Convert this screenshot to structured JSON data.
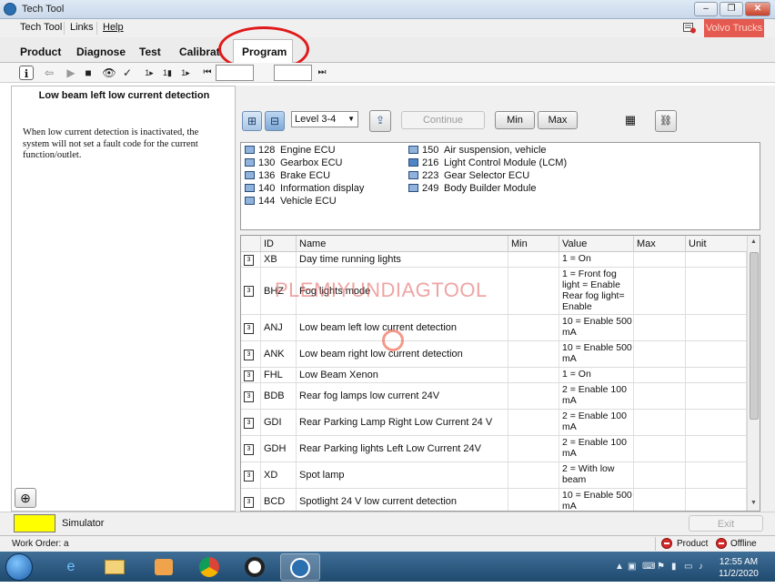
{
  "window": {
    "title": "Tech Tool",
    "controls": [
      "–",
      "❐",
      "✕"
    ]
  },
  "menu": {
    "items": [
      "Tech Tool",
      "Links",
      "Help"
    ],
    "brand_button": "Volvo Trucks"
  },
  "tabs": [
    "Product",
    "Diagnose",
    "Test",
    "Calibrat",
    "Program"
  ],
  "active_tab": "Program",
  "toolbar": {
    "page_input": "",
    "page_input2": ""
  },
  "left_panel": {
    "title": "Low beam left low current detection",
    "description": "When low current detection is inactivated, the system will not set a fault code for the current function/outlet."
  },
  "controls": {
    "level_select": "Level 3-4",
    "continue_label": "Continue",
    "min_label": "Min",
    "max_label": "Max"
  },
  "ecus": [
    {
      "num": "128",
      "name": "Engine ECU"
    },
    {
      "num": "130",
      "name": "Gearbox ECU"
    },
    {
      "num": "136",
      "name": "Brake ECU"
    },
    {
      "num": "140",
      "name": "Information display"
    },
    {
      "num": "144",
      "name": "Vehicle ECU"
    },
    {
      "num": "150",
      "name": "Air suspension, vehicle"
    },
    {
      "num": "216",
      "name": "Light Control Module (LCM)"
    },
    {
      "num": "223",
      "name": "Gear Selector ECU"
    },
    {
      "num": "249",
      "name": "Body Builder Module"
    }
  ],
  "table": {
    "columns": [
      "ID",
      "Name",
      "Min",
      "Value",
      "Max",
      "Unit"
    ],
    "rows": [
      {
        "id": "XB",
        "name": "Day time running lights",
        "min": "",
        "value": "1 = On",
        "max": "",
        "unit": ""
      },
      {
        "id": "BHZ",
        "name": "Fog lights mode",
        "min": "",
        "value": "1 = Front fog light = Enable Rear fog light= Enable",
        "max": "",
        "unit": ""
      },
      {
        "id": "ANJ",
        "name": "Low beam left low current detection",
        "min": "",
        "value": "10 = Enable 500 mA",
        "max": "",
        "unit": ""
      },
      {
        "id": "ANK",
        "name": "Low beam right low current detection",
        "min": "",
        "value": "10 = Enable 500 mA",
        "max": "",
        "unit": ""
      },
      {
        "id": "FHL",
        "name": "Low Beam Xenon",
        "min": "",
        "value": "1 = On",
        "max": "",
        "unit": ""
      },
      {
        "id": "BDB",
        "name": "Rear fog lamps low current 24V",
        "min": "",
        "value": "2 = Enable 100 mA",
        "max": "",
        "unit": ""
      },
      {
        "id": "GDI",
        "name": "Rear Parking Lamp Right Low Current 24 V",
        "min": "",
        "value": "2 = Enable 100 mA",
        "max": "",
        "unit": ""
      },
      {
        "id": "GDH",
        "name": "Rear Parking lights Left Low Current 24V",
        "min": "",
        "value": "2 = Enable 100 mA",
        "max": "",
        "unit": ""
      },
      {
        "id": "XD",
        "name": "Spot lamp",
        "min": "",
        "value": "2 = With low beam",
        "max": "",
        "unit": ""
      },
      {
        "id": "BCD",
        "name": "Spotlight 24 V low current detection",
        "min": "",
        "value": "10 = Enable 500 mA",
        "max": "",
        "unit": ""
      }
    ]
  },
  "watermark": "PLEMIYUNDIAGTOOL",
  "simulator": {
    "label": "Simulator",
    "swatch_color": "#ffff00",
    "exit_label": "Exit"
  },
  "statusbar": {
    "work_order": "Work Order: a",
    "product_status": "Product",
    "offline_status": "Offline"
  },
  "taskbar": {
    "time": "12:55 AM",
    "date": "11/2/2020"
  }
}
